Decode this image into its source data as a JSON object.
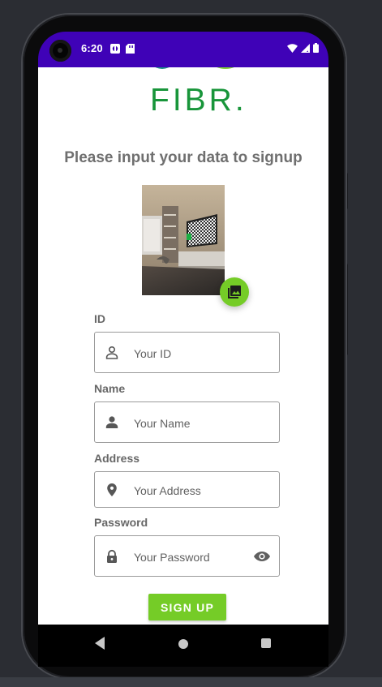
{
  "status_bar": {
    "time": "6:20",
    "left_icons": [
      "app-icon",
      "sd-card-icon"
    ],
    "right_icons": [
      "wifi-icon",
      "signal-icon",
      "battery-icon"
    ]
  },
  "logo": {
    "text": "FIBR."
  },
  "signup": {
    "headline": "Please input your data to signup",
    "photo_button_icon": "image-picker-icon",
    "fields": [
      {
        "label": "ID",
        "placeholder": "Your ID",
        "icon": "person-outline-icon"
      },
      {
        "label": "Name",
        "placeholder": "Your Name",
        "icon": "person-icon"
      },
      {
        "label": "Address",
        "placeholder": "Your Address",
        "icon": "location-pin-icon"
      },
      {
        "label": "Password",
        "placeholder": "Your Password",
        "icon": "lock-icon",
        "trailing_icon": "eye-icon"
      }
    ],
    "button_label": "SIGN UP"
  },
  "navigation": {
    "icons": [
      "back-icon",
      "home-icon",
      "recent-apps-icon"
    ]
  },
  "colors": {
    "status_bar": "#3f02b7",
    "brand_green": "#18953a",
    "accent_green": "#75cc27",
    "logo_teal": "#1b8d86"
  }
}
